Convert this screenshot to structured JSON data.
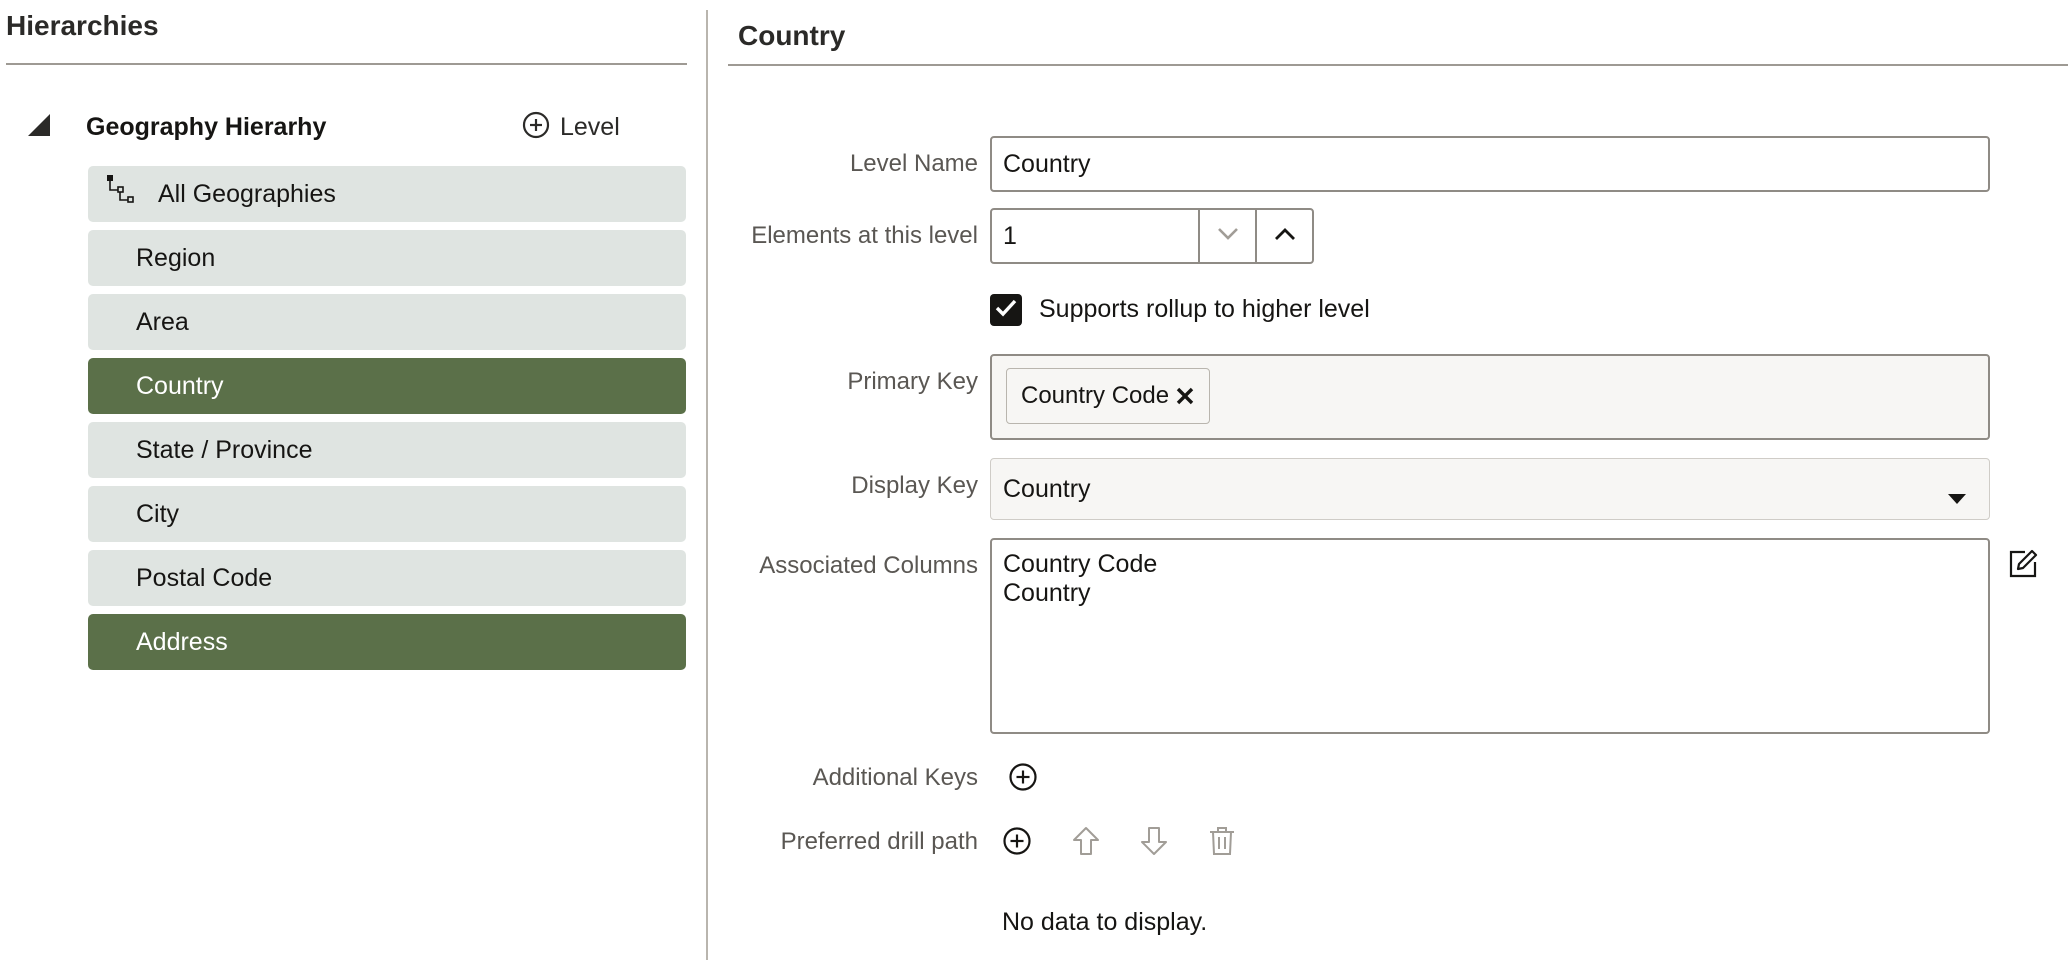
{
  "hierarchies_panel": {
    "title": "Hierarchies",
    "hierarchy_name": "Geography Hierarhy",
    "add_level_label": "Level",
    "levels": [
      {
        "label": "All Geographies",
        "selected": false,
        "is_root": true
      },
      {
        "label": "Region",
        "selected": false
      },
      {
        "label": "Area",
        "selected": false
      },
      {
        "label": "Country",
        "selected": true
      },
      {
        "label": "State / Province",
        "selected": false
      },
      {
        "label": "City",
        "selected": false
      },
      {
        "label": "Postal Code",
        "selected": false
      },
      {
        "label": "Address",
        "selected": true
      }
    ]
  },
  "level_detail": {
    "title": "Country",
    "level_name_label": "Level Name",
    "level_name_value": "Country",
    "elements_label": "Elements at this level",
    "elements_value": "1",
    "rollup_checked": true,
    "rollup_label": "Supports rollup to higher level",
    "primary_key_label": "Primary Key",
    "primary_key_chip": "Country Code",
    "display_key_label": "Display Key",
    "display_key_value": "Country",
    "associated_columns_label": "Associated Columns",
    "associated_columns": [
      "Country Code",
      "Country"
    ],
    "additional_keys_label": "Additional Keys",
    "drill_path_label": "Preferred drill path",
    "no_data_text": "No data to display."
  },
  "colors": {
    "selected_level": "#5b7049",
    "unselected_level": "#dfe4e1",
    "text": "#161513",
    "label": "#5a5753"
  },
  "icons": {
    "tree_toggle": "expanded-triangle-icon",
    "add_level": "plus-circle-icon",
    "root_level": "hierarchy-tree-icon",
    "stepper_down": "chevron-down-icon",
    "stepper_up": "chevron-up-icon",
    "checkbox": "check-icon",
    "chip_remove": "close-icon",
    "select": "caret-down-icon",
    "edit": "edit-icon",
    "add_key": "plus-circle-icon",
    "drill_add": "plus-circle-icon",
    "drill_up": "arrow-up-icon",
    "drill_down": "arrow-down-icon",
    "drill_delete": "trash-icon"
  }
}
